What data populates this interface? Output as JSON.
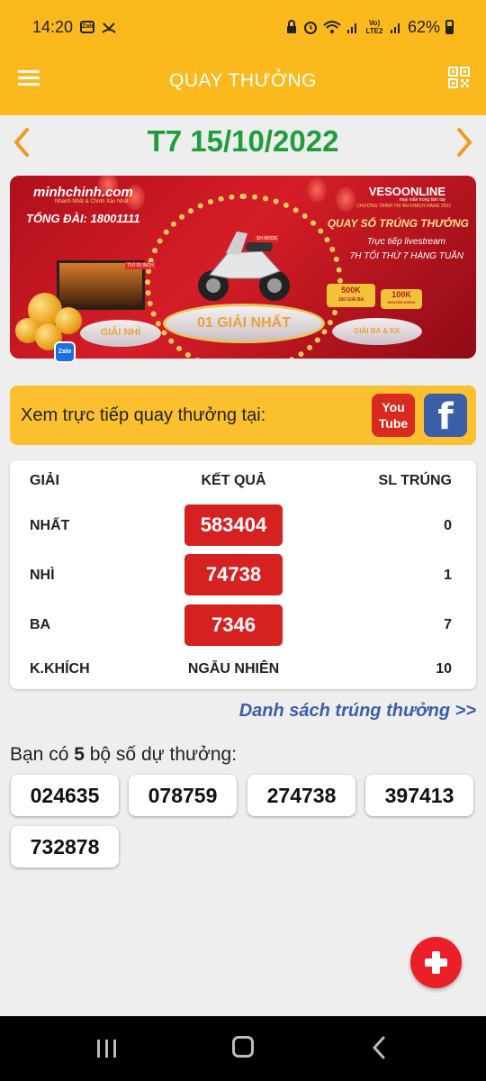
{
  "status_bar": {
    "time": "14:20",
    "zalo_icon": "Zalo",
    "volte_label": "Vo) LTE2",
    "battery": "62%",
    "icons": [
      "zalo-icon",
      "missed-call-icon",
      "lock-icon",
      "alarm-icon",
      "wifi-icon",
      "signal-icon",
      "battery-icon"
    ]
  },
  "app_bar": {
    "title": "QUAY THƯỞNG",
    "menu_icon": "hamburger-menu-icon",
    "qr_icon": "qr-code-icon"
  },
  "date_nav": {
    "date": "T7 15/10/2022",
    "prev_icon": "chevron-left-icon",
    "next_icon": "chevron-right-icon",
    "accent_color": "#1e9e3b",
    "arrow_color": "#f29a1f"
  },
  "banner": {
    "logo": "minhchinh.com",
    "logo_sub": "Nhanh Nhất & Chính Xác Nhất",
    "hotline": "TỔNG ĐÀI: 18001111",
    "brand": "VESOONLINE",
    "brand_sub": "may mắn trong tầm tay",
    "program": "CHƯƠNG TRÌNH TRI ÂN KHÁCH HÀNG 2022",
    "headline": "QUAY SỐ TRÚNG THƯỞNG",
    "line1": "Trực tiếp livestream",
    "line2": "7H TỐI THỨ 7 HÀNG TUẦN",
    "bike_label": "SH MODE",
    "tv_label": "TIVI 55 INCH",
    "prize_main": "01 GIẢI NHẤT",
    "prize_second": "GIẢI NHÌ",
    "prize_third": "GIẢI BA & KK",
    "tag_500k": "500K",
    "tag_500k_sub": "100 GIẢI BA",
    "tag_100k": "100K",
    "tag_100k_sub": "KHUYẾN KHÍCH",
    "zalo_badge": "Zalo"
  },
  "live": {
    "text": "Xem trực tiếp quay thưởng tại:",
    "youtube_label_1": "You",
    "youtube_label_2": "Tube",
    "facebook_label": "f"
  },
  "results": {
    "headers": {
      "prize": "GIẢI",
      "result": "KẾT QUẢ",
      "winners": "SL TRÚNG"
    },
    "rows": [
      {
        "prize": "NHẤT",
        "result": "583404",
        "winners": "0"
      },
      {
        "prize": "NHÌ",
        "result": "74738",
        "winners": "1"
      },
      {
        "prize": "BA",
        "result": "7346",
        "winners": "7"
      },
      {
        "prize": "K.KHÍCH",
        "result": "NGẪU NHIÊN",
        "winners": "10"
      }
    ],
    "result_box_color": "#d62121"
  },
  "winners_link": "Danh sách trúng thưởng >>",
  "tickets": {
    "label_prefix": "Bạn có ",
    "count": "5",
    "label_suffix": " bộ số dự thưởng:",
    "numbers": [
      "024635",
      "078759",
      "274738",
      "397413",
      "732878"
    ]
  },
  "fab": {
    "icon": "plus-icon",
    "color": "#ea1f27"
  },
  "nav_bar": {
    "icons": [
      "recent-apps-icon",
      "home-icon",
      "back-icon"
    ]
  },
  "theme": {
    "primary": "#fbb91d",
    "background": "#eeeeee"
  }
}
